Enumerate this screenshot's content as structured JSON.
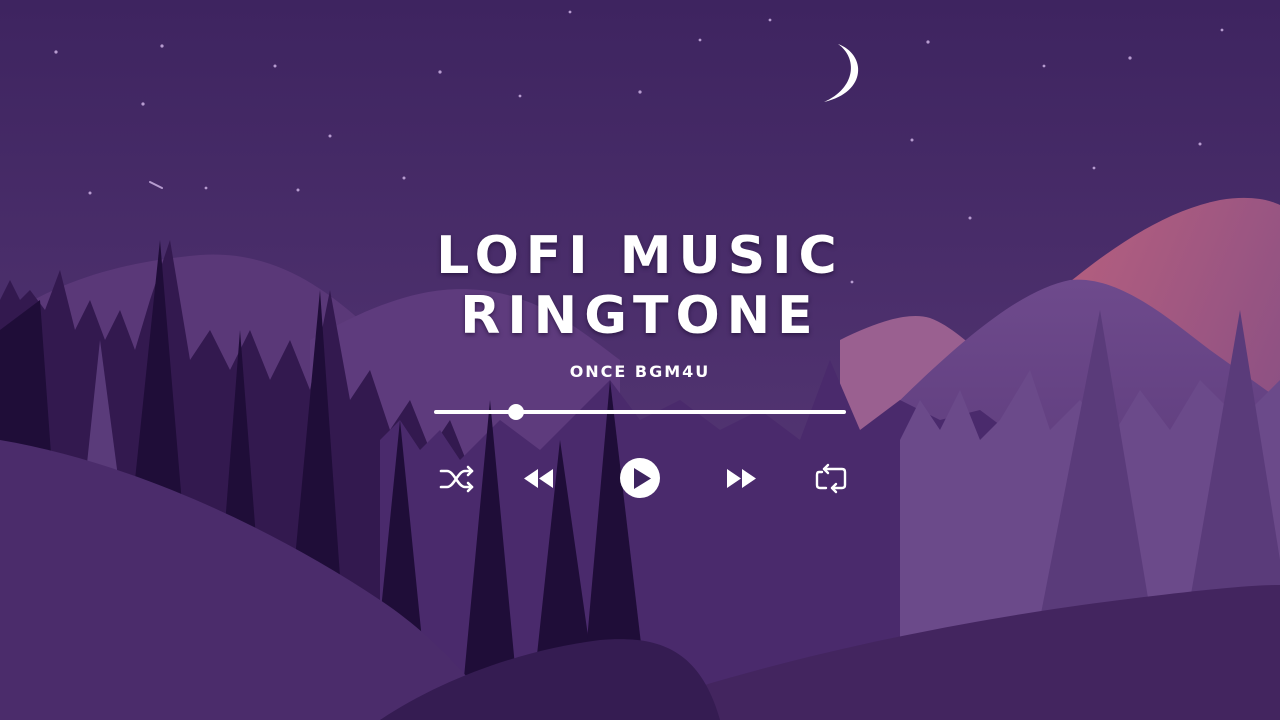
{
  "title": {
    "line1": "LOFI MUSIC",
    "line2": "RINGTONE"
  },
  "artist": "ONCE BGM4U",
  "player": {
    "progress": 0.2,
    "controls": [
      "shuffle-icon",
      "rewind-icon",
      "play-icon",
      "fast-forward-icon",
      "repeat-icon"
    ]
  },
  "colors": {
    "sky_top": "#3e2460",
    "sky_bottom": "#5c3c7a",
    "mountain_pink": "#b06080",
    "tree_dark": "#22103d",
    "foreground": "#4a2a6a",
    "controls": "#ffffff"
  }
}
